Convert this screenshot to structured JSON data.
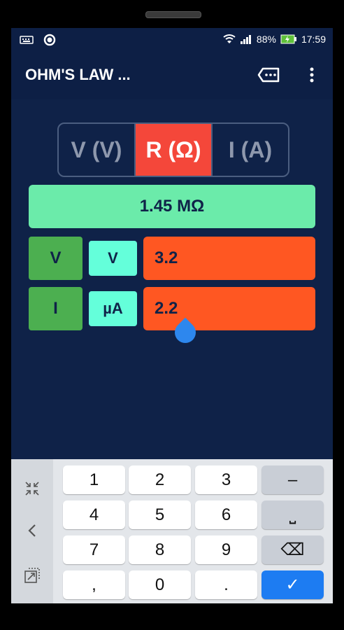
{
  "status": {
    "battery": "88%",
    "time": "17:59"
  },
  "appbar": {
    "title": "OHM'S LAW ...",
    "tag_icon": "label-icon",
    "more_icon": "more-vert-icon"
  },
  "tabs": [
    {
      "label": "V (V)",
      "active": false
    },
    {
      "label": "R (Ω)",
      "active": true
    },
    {
      "label": "I (A)",
      "active": false
    }
  ],
  "result": "1.45 MΩ",
  "inputs": [
    {
      "quantity": "V",
      "unit": "V",
      "value": "3.2"
    },
    {
      "quantity": "I",
      "unit": "µA",
      "value": "2.2"
    }
  ],
  "keyboard": {
    "keys": [
      "1",
      "2",
      "3",
      "–",
      "4",
      "5",
      "6",
      "⎵",
      "7",
      "8",
      "9",
      "⌫",
      ",",
      "0",
      ".",
      "✓"
    ]
  },
  "colors": {
    "background": "#0f2248",
    "active_tab": "#f4473a",
    "result": "#6bebaa",
    "quantity_button": "#4caf50",
    "unit_button": "#64ffda",
    "value_field": "#ff5722",
    "enter_key": "#1d7cf2"
  }
}
